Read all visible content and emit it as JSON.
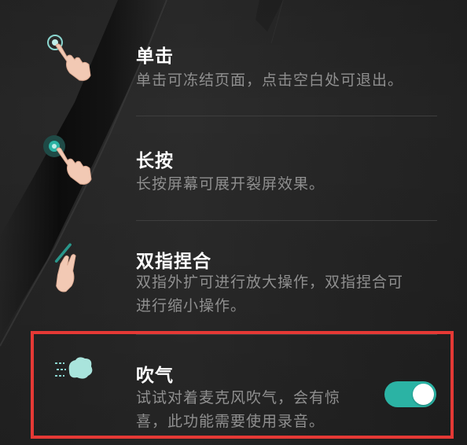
{
  "options": [
    {
      "title": "单击",
      "desc_lines": [
        "单击可冻结页面，点击空白处可退出。"
      ],
      "icon": "single-tap-gesture-icon"
    },
    {
      "title": "长按",
      "desc_lines": [
        "长按屏幕可展开裂屏效果。"
      ],
      "icon": "long-press-gesture-icon"
    },
    {
      "title": "双指捏合",
      "desc_lines": [
        "双指外扩可进行放大操作，双指捏合可",
        "进行缩小操作。"
      ],
      "icon": "pinch-gesture-icon"
    },
    {
      "title": "吹气",
      "desc_lines": [
        "试试对着麦克风吹气，会有惊",
        "喜，此功能需要使用录音。"
      ],
      "icon": "blow-air-icon",
      "toggle_on": true
    }
  ],
  "colors": {
    "accent": "#2bb3a4",
    "highlight": "#e53935",
    "title": "#ffffff",
    "desc": "#8f8f8f"
  }
}
